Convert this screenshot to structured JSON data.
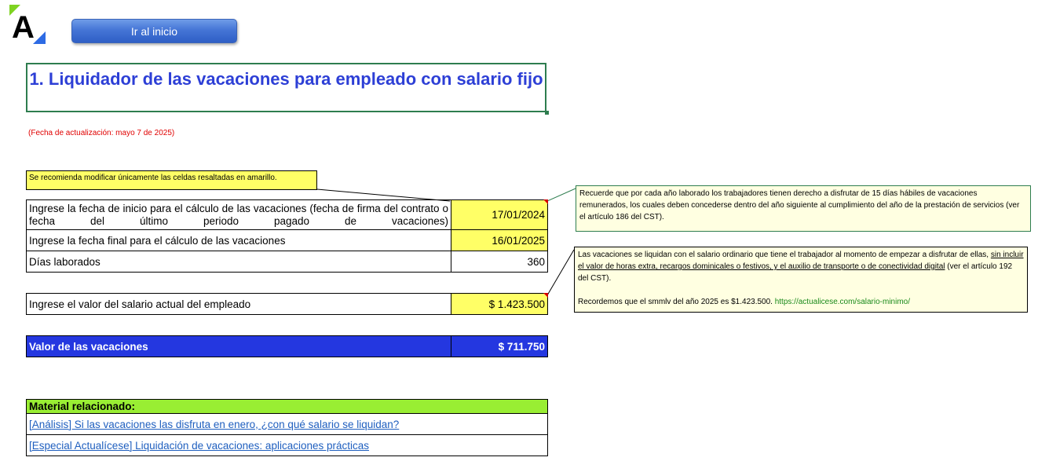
{
  "logo": {
    "letter": "A",
    "accent_green": "#7ed321",
    "accent_blue": "#2d6be4"
  },
  "home_button": {
    "label": "Ir al inicio"
  },
  "title": "1. Liquidador de las vacaciones para empleado con salario fijo",
  "update_note": "(Fecha de actualización: mayo 7 de 2025)",
  "recommendation": "Se recomienda modificar únicamente las celdas resaltadas en amarillo.",
  "form": {
    "start_date": {
      "label": "Ingrese la fecha de inicio para el cálculo de las vacaciones (fecha de firma del contrato o fecha del último periodo pagado de vacaciones)",
      "value": "17/01/2024"
    },
    "end_date": {
      "label": "Ingrese la fecha final para el cálculo de las vacaciones",
      "value": "16/01/2025"
    },
    "days_worked": {
      "label": "Días laborados",
      "value": "360"
    },
    "salary": {
      "label": "Ingrese el valor del salario actual del empleado",
      "value": "$ 1.423.500"
    },
    "result": {
      "label": "Valor de las vacaciones",
      "value": "$ 711.750"
    }
  },
  "comments": {
    "vacation_days": "Recuerde que por cada año laborado los trabajadores tienen derecho a disfrutar de 15 días hábiles de vacaciones remunerados, los cuales deben concederse dentro del año siguiente al cumplimiento del año de la prestación de servicios (ver el artículo 186 del CST).",
    "salary_intro": "Las vacaciones se liquidan con el salario ordinario que tiene el trabajador al momento de empezar a disfrutar de ellas, ",
    "salary_underlined": "sin incluir el valor de horas extra, recargos dominicales o festivos, y el auxilio de transporte o de conectividad digital",
    "salary_ref": " (ver el artículo 192 del CST).",
    "smmlv_text": "Recordemos que el smmlv del año 2025 es $1.423.500. ",
    "smmlv_link": "https://actualicese.com/salario-minimo/"
  },
  "related": {
    "header": "Material relacionado:",
    "links": [
      "[Análisis] Si las vacaciones las disfruta en enero, ¿con qué salario se liquidan?",
      "[Especial Actualícese] Liquidación de vacaciones: aplicaciones prácticas"
    ]
  }
}
